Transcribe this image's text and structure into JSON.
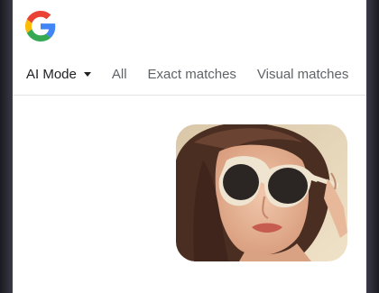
{
  "app": {
    "logo_icon": "google-g-logo",
    "brand_colors": [
      "#4285F4",
      "#EA4335",
      "#FBBC05",
      "#34A853"
    ]
  },
  "tabs": [
    {
      "label": "AI Mode",
      "selected": true,
      "has_dropdown": true
    },
    {
      "label": "All",
      "selected": false
    },
    {
      "label": "Exact matches",
      "selected": false
    },
    {
      "label": "Visual matches",
      "selected": false
    }
  ],
  "query_image": {
    "icon": "query-photo-thumbnail"
  }
}
